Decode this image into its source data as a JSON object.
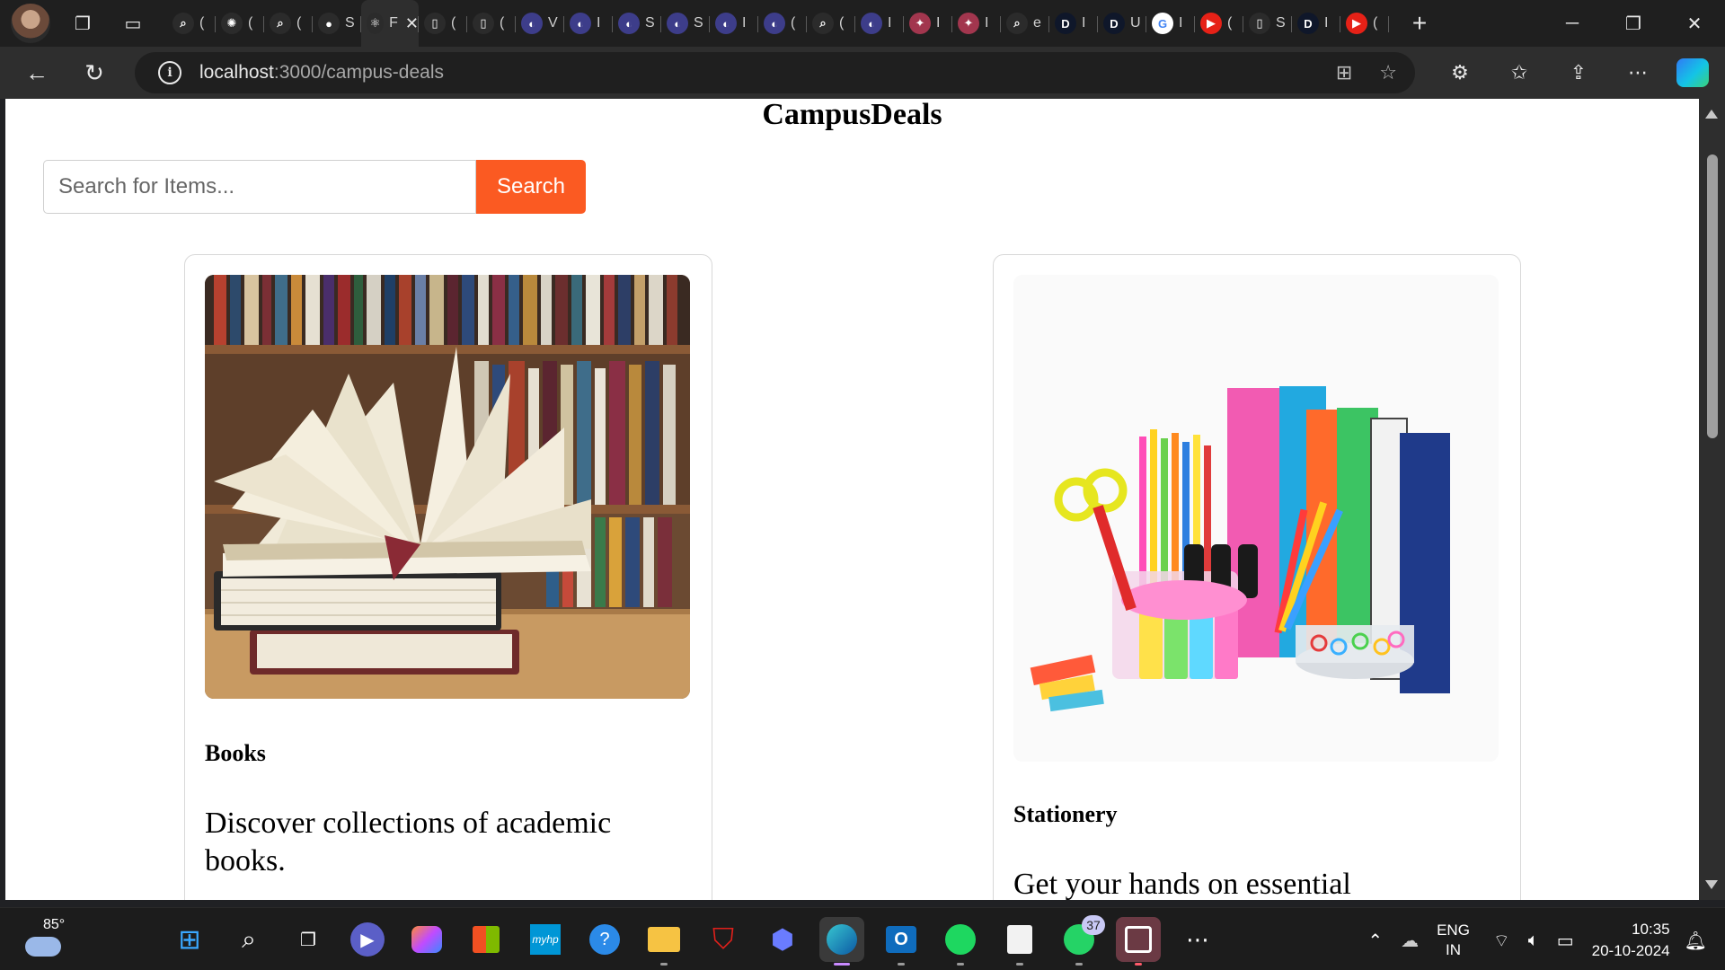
{
  "browser": {
    "tabs": [
      {
        "icon": "search-icon",
        "glyph": "⌕",
        "color": "#2b2b2b",
        "text": "(",
        "active": false
      },
      {
        "icon": "chatgpt-icon",
        "glyph": "✺",
        "color": "#2b2b2b",
        "text": "(",
        "active": false
      },
      {
        "icon": "search-icon",
        "glyph": "⌕",
        "color": "#2b2b2b",
        "text": "(",
        "active": false
      },
      {
        "icon": "github-icon",
        "glyph": "●",
        "color": "#2b2b2b",
        "text": "S",
        "active": false
      },
      {
        "icon": "react-icon",
        "glyph": "⚛",
        "color": "#2b2b2b",
        "text": "F",
        "active": true
      },
      {
        "icon": "page-icon",
        "glyph": "▯",
        "color": "#2b2b2b",
        "text": "(",
        "active": false
      },
      {
        "icon": "page-icon",
        "glyph": "▯",
        "color": "#2b2b2b",
        "text": "(",
        "active": false
      },
      {
        "icon": "generic-app-icon",
        "glyph": "◐",
        "color": "#3d3d8a",
        "text": "V",
        "active": false
      },
      {
        "icon": "generic-app-icon",
        "glyph": "◐",
        "color": "#3d3d8a",
        "text": "I",
        "active": false
      },
      {
        "icon": "generic-app-icon",
        "glyph": "◐",
        "color": "#3d3d8a",
        "text": "S",
        "active": false
      },
      {
        "icon": "generic-app-icon",
        "glyph": "◐",
        "color": "#3d3d8a",
        "text": "S",
        "active": false
      },
      {
        "icon": "generic-app-icon",
        "glyph": "◐",
        "color": "#3d3d8a",
        "text": "I",
        "active": false
      },
      {
        "icon": "generic-app-icon",
        "glyph": "◐",
        "color": "#3d3d8a",
        "text": "(",
        "active": false
      },
      {
        "icon": "search-icon",
        "glyph": "⌕",
        "color": "#2b2b2b",
        "text": "(",
        "active": false
      },
      {
        "icon": "generic-app-icon",
        "glyph": "◐",
        "color": "#3d3d8a",
        "text": "I",
        "active": false
      },
      {
        "icon": "figma-icon",
        "glyph": "✦",
        "color": "#a2364e",
        "text": "I",
        "active": false
      },
      {
        "icon": "figma-icon",
        "glyph": "✦",
        "color": "#a2364e",
        "text": "I",
        "active": false
      },
      {
        "icon": "search-icon",
        "glyph": "⌕",
        "color": "#2b2b2b",
        "text": "e",
        "active": false
      },
      {
        "icon": "d-app-icon",
        "glyph": "D",
        "color": "#0f172a",
        "text": "I",
        "active": false
      },
      {
        "icon": "d-app-icon",
        "glyph": "D",
        "color": "#0f172a",
        "text": "U",
        "active": false
      },
      {
        "icon": "google-icon",
        "glyph": "G",
        "color": "#ffffff",
        "text": "I",
        "active": false
      },
      {
        "icon": "youtube-icon",
        "glyph": "▶",
        "color": "#e62117",
        "text": "(",
        "active": false
      },
      {
        "icon": "page-icon",
        "glyph": "▯",
        "color": "#2b2b2b",
        "text": "S",
        "active": false
      },
      {
        "icon": "d-app-icon",
        "glyph": "D",
        "color": "#0f172a",
        "text": "I",
        "active": false
      },
      {
        "icon": "youtube-icon",
        "glyph": "▶",
        "color": "#e62117",
        "text": "(",
        "active": false
      }
    ],
    "url_host": "localhost",
    "url_path": ":3000/campus-deals"
  },
  "page": {
    "title": "CampusDeals",
    "search": {
      "placeholder": "Search for Items...",
      "button_label": "Search"
    },
    "cards": [
      {
        "title": "Books",
        "description": "Discover collections of academic books."
      },
      {
        "title": "Stationery",
        "description": "Get your hands on essential"
      }
    ]
  },
  "taskbar": {
    "weather_temp": "85°",
    "whatsapp_badge": "37",
    "lang_line1": "ENG",
    "lang_line2": "IN",
    "time": "10:35",
    "date": "20-10-2024"
  },
  "colors": {
    "accent": "#fb5a22"
  }
}
